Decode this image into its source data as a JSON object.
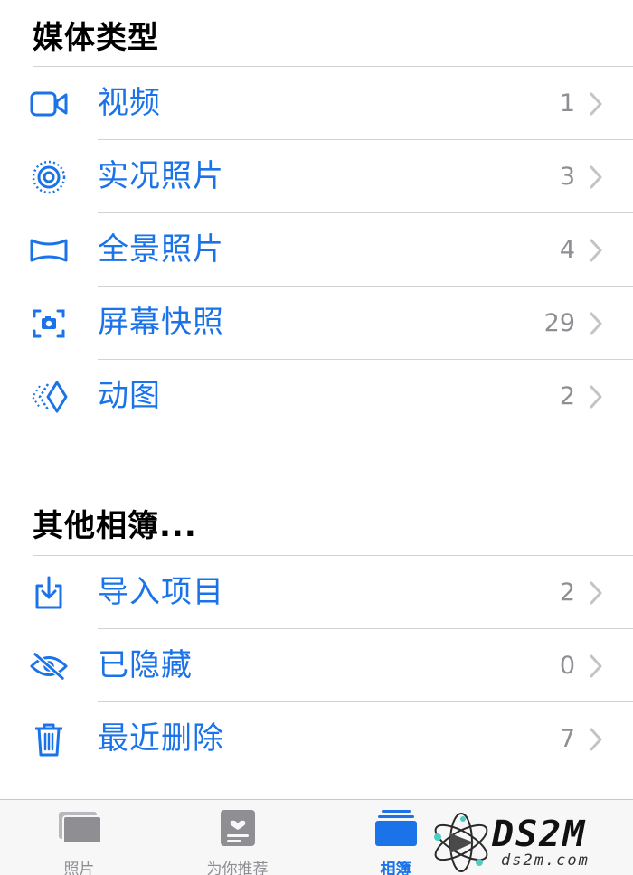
{
  "media_types": {
    "title": "媒体类型",
    "items": [
      {
        "label": "视频",
        "count": "1",
        "icon": "video-icon"
      },
      {
        "label": "实况照片",
        "count": "3",
        "icon": "live-photo-icon"
      },
      {
        "label": "全景照片",
        "count": "4",
        "icon": "panorama-icon"
      },
      {
        "label": "屏幕快照",
        "count": "29",
        "icon": "screenshot-icon"
      },
      {
        "label": "动图",
        "count": "2",
        "icon": "animated-icon"
      }
    ]
  },
  "other_albums": {
    "title": "其他相簿...",
    "items": [
      {
        "label": "导入项目",
        "count": "2",
        "icon": "import-icon"
      },
      {
        "label": "已隐藏",
        "count": "0",
        "icon": "hidden-eye-icon"
      },
      {
        "label": "最近删除",
        "count": "7",
        "icon": "trash-icon"
      }
    ]
  },
  "tabbar": {
    "tabs": [
      {
        "label": "照片",
        "icon": "photos-tab-icon",
        "active": false
      },
      {
        "label": "为你推荐",
        "icon": "for-you-tab-icon",
        "active": false
      },
      {
        "label": "相簿",
        "icon": "albums-tab-icon",
        "active": true
      }
    ]
  },
  "watermark": {
    "text": "DS2M",
    "subtext": "ds2m.com"
  },
  "colors": {
    "accent": "#1a73e8",
    "secondary_text": "#8e8e93",
    "separator": "#d1d1d6"
  }
}
